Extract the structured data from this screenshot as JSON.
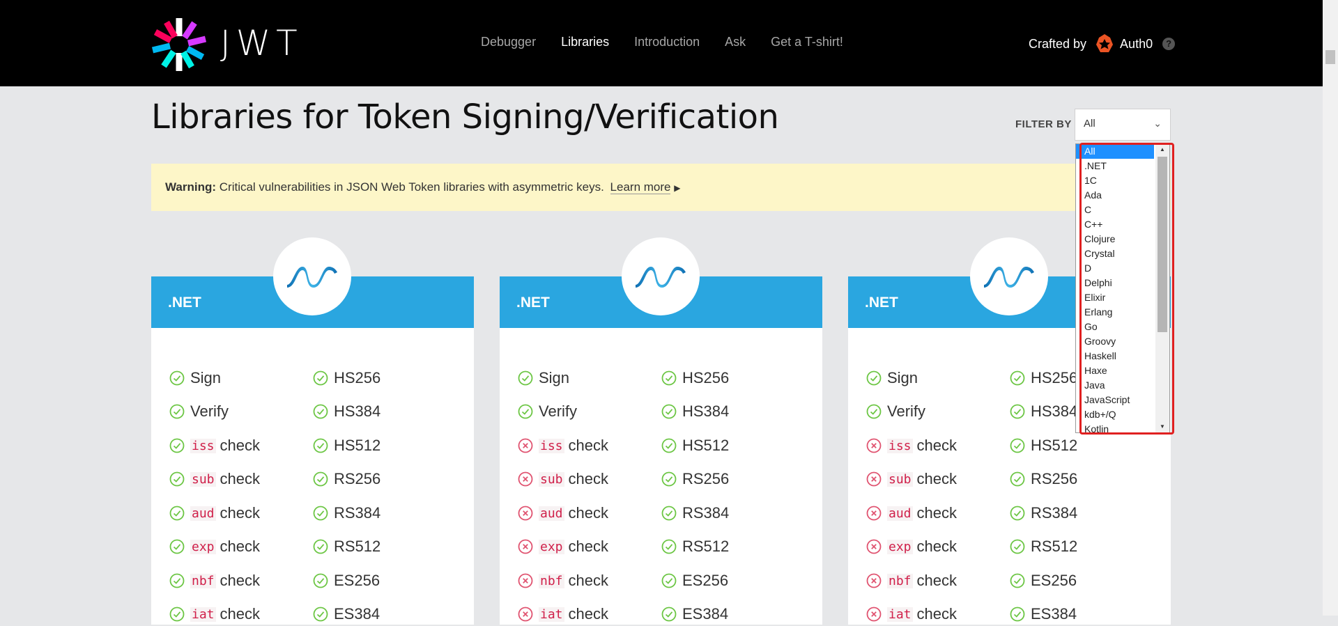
{
  "header": {
    "brand": "JWT",
    "nav": [
      "Debugger",
      "Libraries",
      "Introduction",
      "Ask",
      "Get a T-shirt!"
    ],
    "active_nav": "Libraries",
    "crafted_label": "Crafted by",
    "auth0_name": "Auth0",
    "help_glyph": "?"
  },
  "page": {
    "title": "Libraries for Token Signing/Verification",
    "filter_label": "FILTER BY",
    "filter_value": "All",
    "filter_options": [
      "All",
      ".NET",
      "1C",
      "Ada",
      "C",
      "C++",
      "Clojure",
      "Crystal",
      "D",
      "Delphi",
      "Elixir",
      "Erlang",
      "Go",
      "Groovy",
      "Haskell",
      "Haxe",
      "Java",
      "JavaScript",
      "kdb+/Q",
      "Kotlin"
    ]
  },
  "warning": {
    "label": "Warning:",
    "text": "Critical vulnerabilities in JSON Web Token libraries with asymmetric keys.",
    "link": "Learn more"
  },
  "check_word": "check",
  "colors": {
    "accent": "#2aa6e0",
    "ok": "#6cc644",
    "fail": "#e05370"
  },
  "cards": [
    {
      "lang": ".NET",
      "left": [
        {
          "code": "",
          "label": "Sign",
          "ok": true
        },
        {
          "code": "",
          "label": "Verify",
          "ok": true
        },
        {
          "code": "iss",
          "label": "check",
          "ok": true
        },
        {
          "code": "sub",
          "label": "check",
          "ok": true
        },
        {
          "code": "aud",
          "label": "check",
          "ok": true
        },
        {
          "code": "exp",
          "label": "check",
          "ok": true
        },
        {
          "code": "nbf",
          "label": "check",
          "ok": true
        },
        {
          "code": "iat",
          "label": "check",
          "ok": true
        }
      ],
      "right": [
        {
          "label": "HS256",
          "ok": true
        },
        {
          "label": "HS384",
          "ok": true
        },
        {
          "label": "HS512",
          "ok": true
        },
        {
          "label": "RS256",
          "ok": true
        },
        {
          "label": "RS384",
          "ok": true
        },
        {
          "label": "RS512",
          "ok": true
        },
        {
          "label": "ES256",
          "ok": true
        },
        {
          "label": "ES384",
          "ok": true
        }
      ]
    },
    {
      "lang": ".NET",
      "left": [
        {
          "code": "",
          "label": "Sign",
          "ok": true
        },
        {
          "code": "",
          "label": "Verify",
          "ok": true
        },
        {
          "code": "iss",
          "label": "check",
          "ok": false
        },
        {
          "code": "sub",
          "label": "check",
          "ok": false
        },
        {
          "code": "aud",
          "label": "check",
          "ok": false
        },
        {
          "code": "exp",
          "label": "check",
          "ok": false
        },
        {
          "code": "nbf",
          "label": "check",
          "ok": false
        },
        {
          "code": "iat",
          "label": "check",
          "ok": false
        }
      ],
      "right": [
        {
          "label": "HS256",
          "ok": true
        },
        {
          "label": "HS384",
          "ok": true
        },
        {
          "label": "HS512",
          "ok": true
        },
        {
          "label": "RS256",
          "ok": true
        },
        {
          "label": "RS384",
          "ok": true
        },
        {
          "label": "RS512",
          "ok": true
        },
        {
          "label": "ES256",
          "ok": true
        },
        {
          "label": "ES384",
          "ok": true
        }
      ]
    },
    {
      "lang": ".NET",
      "left": [
        {
          "code": "",
          "label": "Sign",
          "ok": true
        },
        {
          "code": "",
          "label": "Verify",
          "ok": true
        },
        {
          "code": "iss",
          "label": "check",
          "ok": false
        },
        {
          "code": "sub",
          "label": "check",
          "ok": false
        },
        {
          "code": "aud",
          "label": "check",
          "ok": false
        },
        {
          "code": "exp",
          "label": "check",
          "ok": false
        },
        {
          "code": "nbf",
          "label": "check",
          "ok": false
        },
        {
          "code": "iat",
          "label": "check",
          "ok": false
        }
      ],
      "right": [
        {
          "label": "HS256",
          "ok": true
        },
        {
          "label": "HS384",
          "ok": true
        },
        {
          "label": "HS512",
          "ok": true
        },
        {
          "label": "RS256",
          "ok": true
        },
        {
          "label": "RS384",
          "ok": true
        },
        {
          "label": "RS512",
          "ok": true
        },
        {
          "label": "ES256",
          "ok": true
        },
        {
          "label": "ES384",
          "ok": true
        }
      ]
    }
  ]
}
